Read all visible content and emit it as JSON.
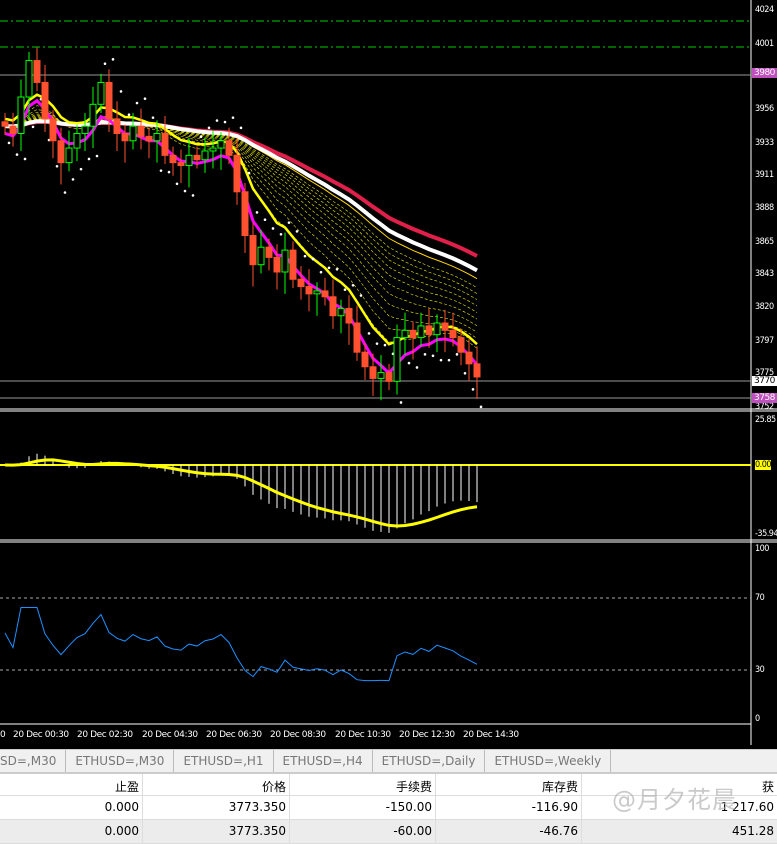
{
  "price_axis": {
    "labels": [
      "4024",
      "4001",
      "3956",
      "3933",
      "3911",
      "3888",
      "3865",
      "3843",
      "3820",
      "3797",
      "3775",
      "3752"
    ],
    "tag_high": "3980",
    "tag_bid": "3770",
    "tag_low": "3758",
    "tag_color": "#c050c0"
  },
  "macd_axis": {
    "top": "25.85",
    "zero": "0.00",
    "bottom": "-35.94"
  },
  "rsi_axis": {
    "top": "100",
    "upper": "70",
    "lower": "30",
    "bottom": "0"
  },
  "time_labels": [
    "0",
    "20 Dec 00:30",
    "20 Dec 02:30",
    "20 Dec 04:30",
    "20 Dec 06:30",
    "20 Dec 08:30",
    "20 Dec 10:30",
    "20 Dec 12:30",
    "20 Dec 14:30"
  ],
  "tabs": [
    "SD=,M30",
    "ETHUSD=,M30",
    "ETHUSD=,H1",
    "ETHUSD=,H4",
    "ETHUSD=,Daily",
    "ETHUSD=,Weekly"
  ],
  "table": {
    "headers": [
      "止盈",
      "价格",
      "手续费",
      "库存费",
      "获"
    ],
    "rows": [
      [
        "0.000",
        "3773.350",
        "-150.00",
        "-116.90",
        "1 217.60"
      ],
      [
        "0.000",
        "3773.350",
        "-60.00",
        "-46.76",
        "451.28"
      ]
    ]
  },
  "watermark": "@月夕花晨",
  "chart_data": {
    "type": "candlestick",
    "symbol": "ETHUSD",
    "closes": [
      3945,
      3940,
      3965,
      3990,
      3975,
      3950,
      3935,
      3920,
      3930,
      3940,
      3945,
      3960,
      3975,
      3950,
      3940,
      3935,
      3945,
      3938,
      3935,
      3940,
      3925,
      3920,
      3918,
      3925,
      3922,
      3928,
      3930,
      3935,
      3925,
      3900,
      3870,
      3850,
      3862,
      3855,
      3845,
      3860,
      3840,
      3835,
      3830,
      3832,
      3828,
      3815,
      3820,
      3810,
      3790,
      3780,
      3772,
      3776,
      3770,
      3800,
      3805,
      3800,
      3808,
      3802,
      3810,
      3805,
      3800,
      3790,
      3782,
      3773
    ],
    "ylim": [
      3752,
      4024
    ]
  }
}
